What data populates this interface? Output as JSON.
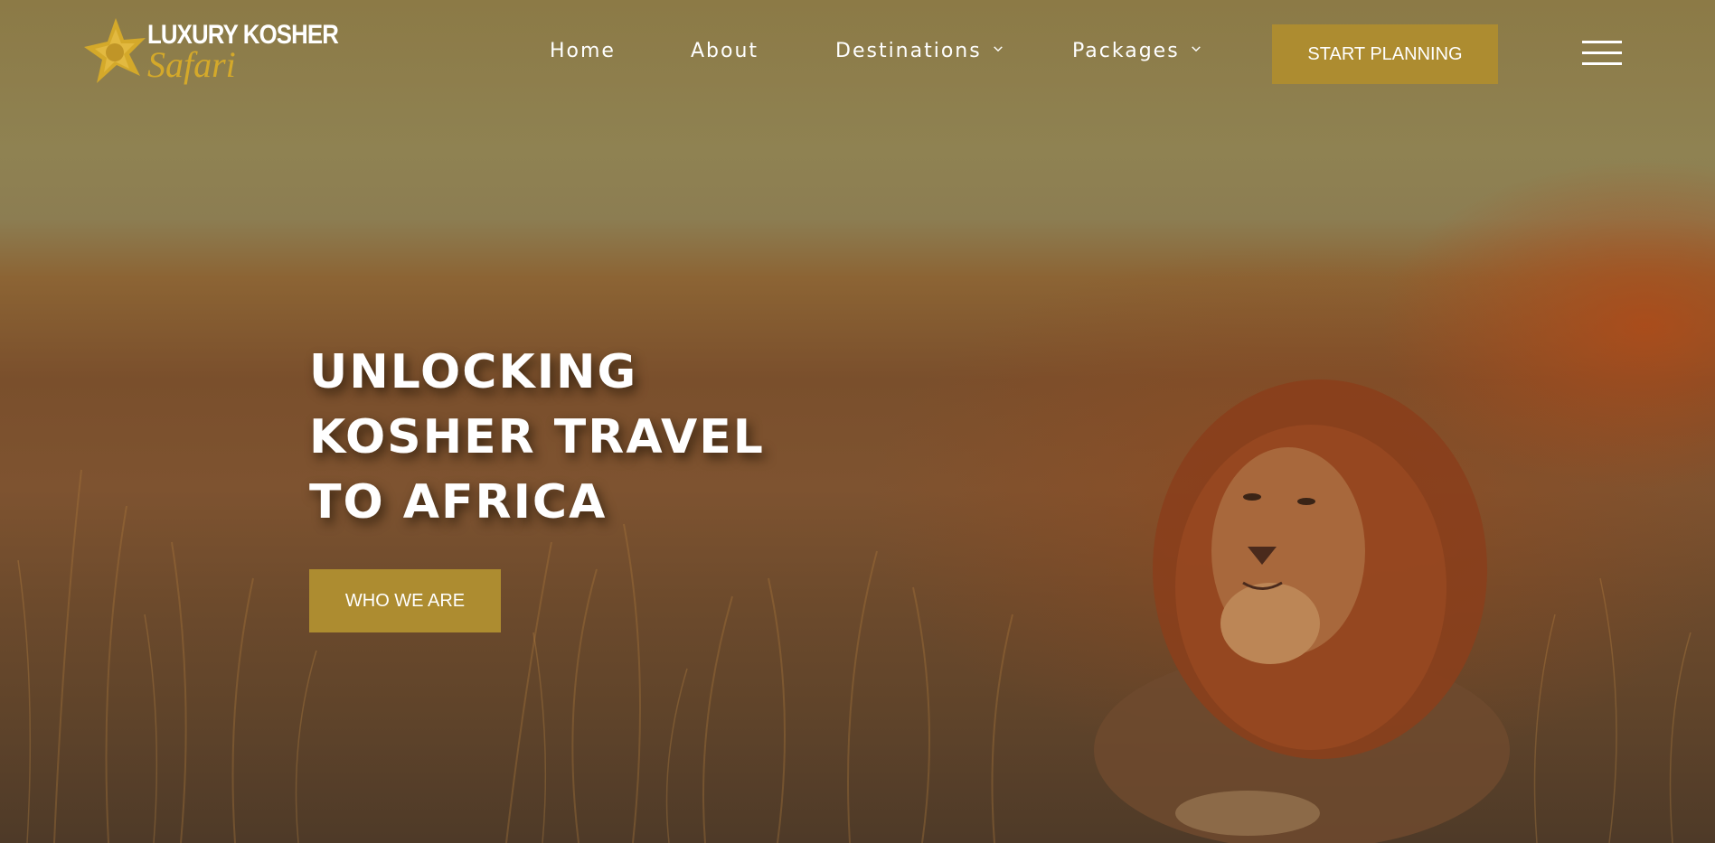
{
  "header": {
    "logo": {
      "line1": "LUXURY KOSHER",
      "line2": "Safari",
      "icon": "star-icon"
    },
    "nav": [
      {
        "label": "Home",
        "has_dropdown": false
      },
      {
        "label": "About",
        "has_dropdown": false
      },
      {
        "label": "Destinations",
        "has_dropdown": true
      },
      {
        "label": "Packages",
        "has_dropdown": true
      }
    ],
    "cta_label": "START PLANNING",
    "menu_icon": "hamburger-menu-icon"
  },
  "hero": {
    "headline": [
      "UNLOCKING",
      "KOSHER TRAVEL",
      "TO AFRICA"
    ],
    "button_label": "WHO WE ARE",
    "image_subject": "lion"
  },
  "colors": {
    "accent": "#ad8c30",
    "logo_gold": "#d4a92a",
    "text": "#ffffff"
  }
}
